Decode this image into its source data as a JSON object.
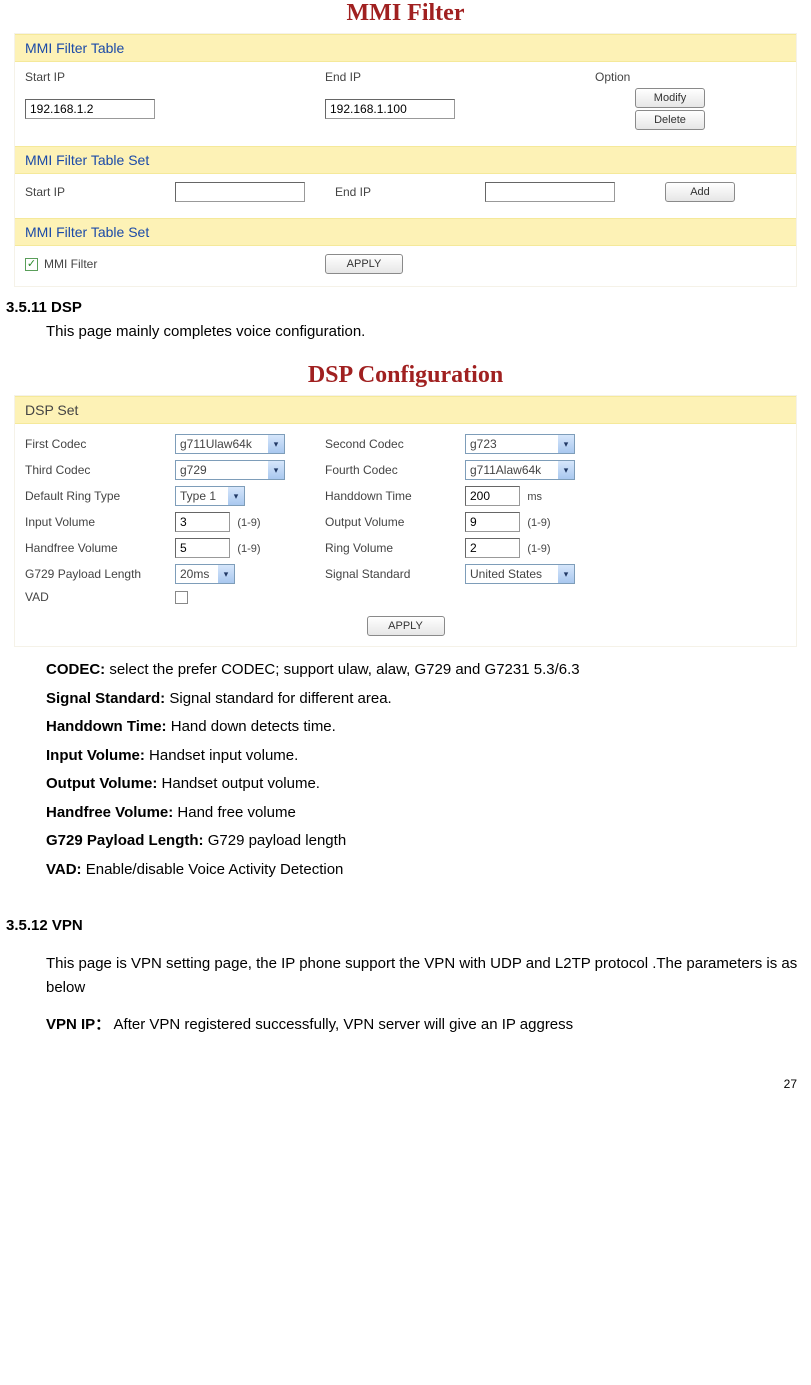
{
  "mmi": {
    "title": "MMI Filter",
    "table_bar": "MMI Filter Table",
    "col_start": "Start IP",
    "col_end": "End IP",
    "col_option": "Option",
    "row": {
      "start": "192.168.1.2",
      "end": "192.168.1.100"
    },
    "btn_modify": "Modify",
    "btn_delete": "Delete",
    "set_bar": "MMI Filter Table Set",
    "btn_add": "Add",
    "chk_label": "MMI Filter",
    "btn_apply": "APPLY"
  },
  "dsp_section": {
    "heading": "3.5.11 DSP",
    "intro": "This page mainly completes voice configuration.",
    "title": "DSP Configuration",
    "bar": "DSP Set",
    "labels": {
      "first_codec": "First Codec",
      "second_codec": "Second Codec",
      "third_codec": "Third Codec",
      "fourth_codec": "Fourth Codec",
      "default_ring": "Default Ring Type",
      "handdown": "Handdown Time",
      "input_vol": "Input Volume",
      "output_vol": "Output Volume",
      "handfree_vol": "Handfree Volume",
      "ring_vol": "Ring Volume",
      "g729": "G729 Payload Length",
      "signal": "Signal Standard",
      "vad": "VAD"
    },
    "values": {
      "first_codec": "g711Ulaw64k",
      "second_codec": "g723",
      "third_codec": "g729",
      "fourth_codec": "g711Alaw64k",
      "default_ring": "Type 1",
      "handdown": "200",
      "handdown_unit": "ms",
      "input_vol": "3",
      "output_vol": "9",
      "handfree_vol": "5",
      "ring_vol": "2",
      "vol_hint": "(1-9)",
      "g729": "20ms",
      "signal": "United States"
    },
    "btn_apply": "APPLY"
  },
  "defs": {
    "codec_t": "CODEC:",
    "codec_d": " select the prefer CODEC; support ulaw, alaw, G729 and G7231 5.3/6.3",
    "signal_t": "Signal Standard:",
    "signal_d": " Signal standard for different area.",
    "handdown_t": "Handdown Time:",
    "handdown_d": " Hand down detects time.",
    "input_t": "Input Volume:",
    "input_d": " Handset input volume.",
    "output_t": "Output Volume:",
    "output_d": " Handset output volume.",
    "handfree_t": "Handfree Volume:",
    "handfree_d": " Hand free volume",
    "g729_t": "G729 Payload Length:",
    "g729_d": " G729 payload length",
    "vad_t": "VAD:",
    "vad_d": "   Enable/disable Voice Activity Detection"
  },
  "vpn_section": {
    "heading": "3.5.12 VPN",
    "intro": "This page is VPN setting page, the IP phone support the VPN with UDP and L2TP protocol .The parameters is as below",
    "vpnip_t": "VPN IP：",
    "vpnip_d": "  After VPN registered successfully, VPN server will give an IP aggress"
  },
  "page_number": "27"
}
